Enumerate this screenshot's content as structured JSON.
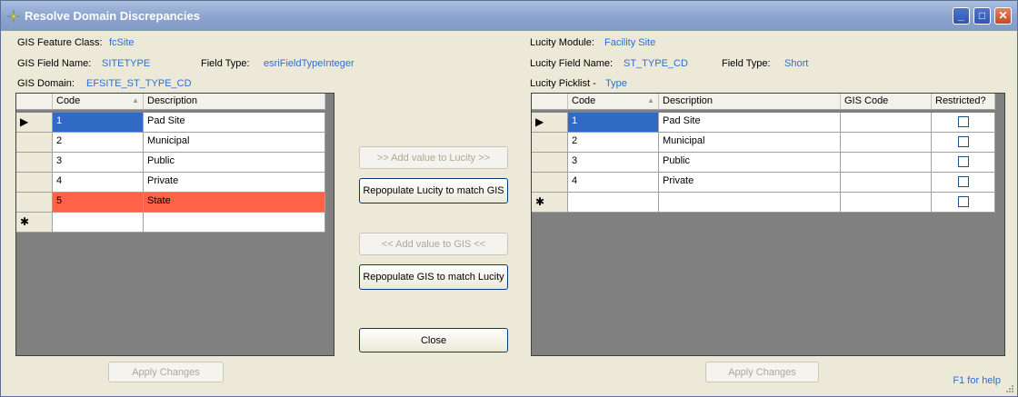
{
  "window": {
    "title": "Resolve Domain Discrepancies",
    "controls": {
      "minimize": "_",
      "maximize": "□",
      "close": "✕"
    }
  },
  "gis": {
    "feature_class_label": "GIS Feature Class:",
    "feature_class": "fcSite",
    "field_name_label": "GIS Field Name:",
    "field_name": "SITETYPE",
    "field_type_label": "Field Type:",
    "field_type": "esriFieldTypeInteger",
    "domain_label": "GIS Domain:",
    "domain": "EFSITE_ST_TYPE_CD",
    "columns": {
      "code": "Code",
      "description": "Description"
    },
    "rows": [
      {
        "code": "1",
        "description": "Pad Site"
      },
      {
        "code": "2",
        "description": "Municipal"
      },
      {
        "code": "3",
        "description": "Public"
      },
      {
        "code": "4",
        "description": "Private"
      },
      {
        "code": "5",
        "description": "State"
      }
    ],
    "apply_button": "Apply Changes"
  },
  "lucity": {
    "module_label": "Lucity Module:",
    "module": "Facility Site",
    "field_name_label": "Lucity Field Name:",
    "field_name": "ST_TYPE_CD",
    "field_type_label": "Field Type:",
    "field_type": "Short",
    "picklist_label": "Lucity Picklist -",
    "picklist": "Type",
    "columns": {
      "code": "Code",
      "description": "Description",
      "gis_code": "GIS Code",
      "restricted": "Restricted?"
    },
    "rows": [
      {
        "code": "1",
        "description": "Pad Site",
        "gis_code": ""
      },
      {
        "code": "2",
        "description": "Municipal",
        "gis_code": ""
      },
      {
        "code": "3",
        "description": "Public",
        "gis_code": ""
      },
      {
        "code": "4",
        "description": "Private",
        "gis_code": ""
      }
    ],
    "apply_button": "Apply Changes"
  },
  "actions": {
    "add_to_lucity": ">> Add value to Lucity >>",
    "repopulate_lucity": "Repopulate Lucity to match GIS",
    "add_to_gis": "<< Add value to GIS <<",
    "repopulate_gis": "Repopulate GIS to match Lucity",
    "close": "Close"
  },
  "row_markers": {
    "current": "▶",
    "new": "✱"
  },
  "sort_indicator": "▲",
  "help_text": "F1 for help",
  "colors": {
    "selected": "#316ac5",
    "discrepancy": "#ff6347",
    "value_text": "#2e6fcf"
  }
}
